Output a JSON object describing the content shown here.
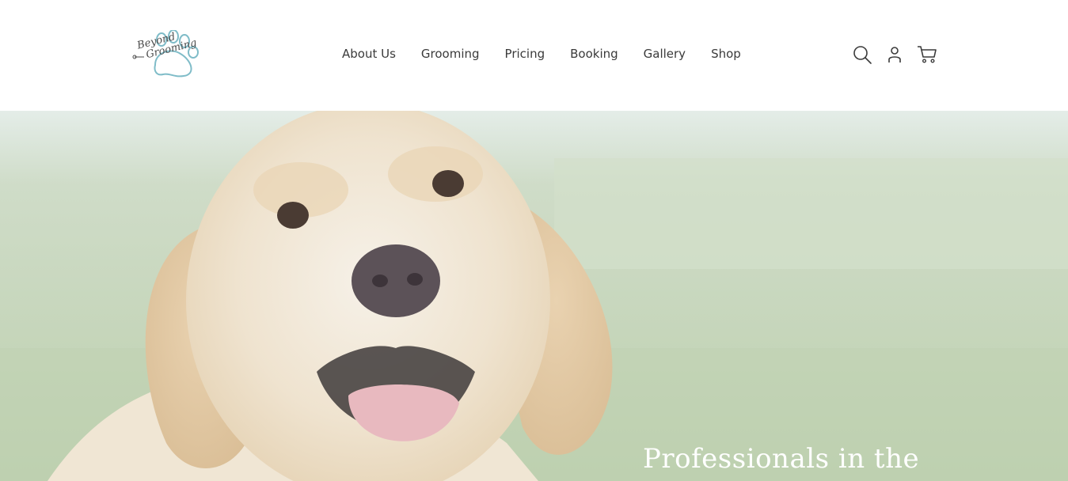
{
  "brand": {
    "logo_line1": "Beyond",
    "logo_line2": "Grooming",
    "accent_color": "#7fbcc8"
  },
  "nav": {
    "items": [
      {
        "label": "About Us"
      },
      {
        "label": "Grooming"
      },
      {
        "label": "Pricing"
      },
      {
        "label": "Booking"
      },
      {
        "label": "Gallery"
      },
      {
        "label": "Shop"
      }
    ]
  },
  "header_icons": [
    "search-icon",
    "account-icon",
    "cart-icon"
  ],
  "hero": {
    "heading": "Professionals in the",
    "image": "smiling golden retriever puppy on grass"
  }
}
